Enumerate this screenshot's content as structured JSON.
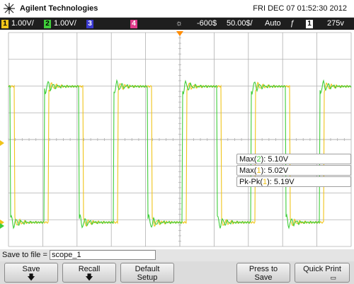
{
  "header": {
    "brand": "Agilent Technologies",
    "datetime": "FRI DEC 07 01:52:30 2012"
  },
  "status": {
    "ch1_num": "1",
    "ch1_scale": "1.00V/",
    "ch2_num": "2",
    "ch2_scale": "1.00V/",
    "ch3_num": "3",
    "ch4_num": "4",
    "trigger_delay": "-600$",
    "timebase": "50.00$/",
    "trigger_mode": "Auto",
    "trigger_slope": "Σ",
    "trigger_source": "1",
    "trigger_level": "275v"
  },
  "measurements": [
    {
      "prefix": "Max(",
      "channel": "2",
      "suffix": "): 5.10V"
    },
    {
      "prefix": "Max(",
      "channel": "1",
      "suffix": "): 5.02V"
    },
    {
      "prefix": "Pk-Pk(",
      "channel": "1",
      "suffix": "): 5.19V"
    }
  ],
  "save": {
    "label": "Save to file =",
    "filename": "scope_1"
  },
  "softkeys": {
    "save": "Save",
    "recall": "Recall",
    "default_1": "Default",
    "default_2": "Setup",
    "press_1": "Press to",
    "press_2": "Save",
    "quick_print": "Quick Print"
  },
  "colors": {
    "ch1": "#f0c419",
    "ch2": "#3fce3a",
    "ch3": "#3a3ad0",
    "ch4": "#e23a8a",
    "grid": "#b0b0b0"
  }
}
